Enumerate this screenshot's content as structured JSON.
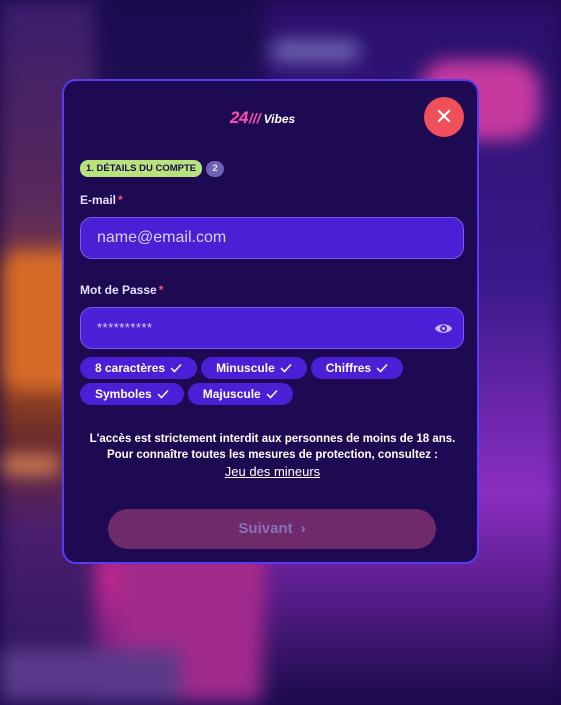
{
  "logo": {
    "number": "24",
    "slashes": "///",
    "word": "Vibes"
  },
  "close": {
    "symbol": "✕"
  },
  "steps": {
    "active": "1. DÉTAILS DU COMPTE",
    "next": "2"
  },
  "email": {
    "label": "E-mail",
    "required": "*",
    "placeholder": "name@email.com"
  },
  "password": {
    "label": "Mot de Passe",
    "required": "*",
    "value": "**********"
  },
  "checks": [
    "8 caractères",
    "Minuscule",
    "Chiffres",
    "Symboles",
    "Majuscule"
  ],
  "legal": {
    "line1": "L'accès est strictement interdit aux personnes de moins de 18 ans.",
    "line2": "Pour connaître toutes les mesures de protection, consultez :",
    "link": "Jeu des mineurs"
  },
  "submit": {
    "label": "Suivant",
    "chevron": "›"
  },
  "colors": {
    "accent": "#4a1fd6",
    "close": "#f0505a",
    "stepBadge": "#b6e47a",
    "brand": "#ff4fb0"
  }
}
